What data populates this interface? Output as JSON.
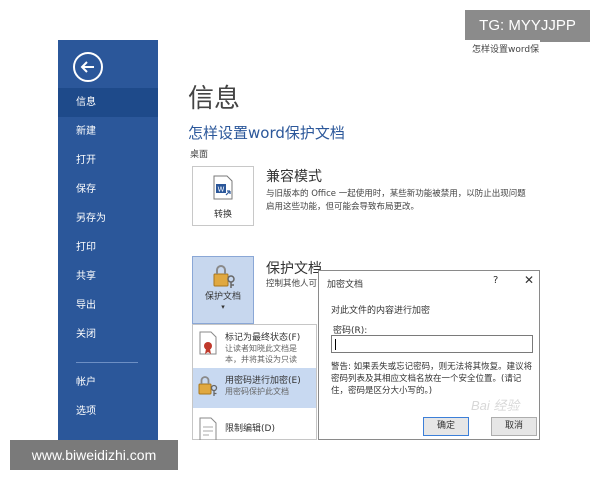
{
  "watermarks": {
    "top": "TG: MYYJJPP",
    "bottom": "www.biweidizhi.com",
    "dialog_logo": "Bai 经验"
  },
  "top_truncated_title": "怎样设置word保",
  "sidebar": {
    "back_icon": "back-arrow-icon",
    "items": [
      {
        "label": "信息",
        "active": true
      },
      {
        "label": "新建"
      },
      {
        "label": "打开"
      },
      {
        "label": "保存"
      },
      {
        "label": "另存为"
      },
      {
        "label": "打印"
      },
      {
        "label": "共享"
      },
      {
        "label": "导出"
      },
      {
        "label": "关闭"
      },
      {
        "label": "帐户"
      },
      {
        "label": "选项"
      }
    ]
  },
  "main": {
    "page_title": "信息",
    "doc_title": "怎样设置word保护文档",
    "doc_location": "桌面",
    "compat": {
      "tile_label": "转换",
      "title": "兼容模式",
      "desc_line1": "与旧版本的 Office 一起使用时，某些新功能被禁用，以防止出现问题",
      "desc_line2": "启用这些功能，但可能会导致布局更改。"
    },
    "protect": {
      "tile_label": "保护文档",
      "tile_caret": "▾",
      "title": "保护文档",
      "desc": "控制其他人可"
    }
  },
  "protect_menu": {
    "items": [
      {
        "title": "标记为最终状态(F)",
        "desc_line1": "让读者知晓此文档是",
        "desc_line2": "本，并将其设为只读"
      },
      {
        "title": "用密码进行加密(E)",
        "desc_line1": "用密码保护此文档",
        "highlighted": true
      },
      {
        "title": "限制编辑(D)"
      }
    ]
  },
  "dialog": {
    "title": "加密文档",
    "help": "?",
    "close": "✕",
    "heading": "对此文件的内容进行加密",
    "password_label": "密码(R):",
    "password_value": "",
    "warning": "警告: 如果丢失或忘记密码，则无法将其恢复。建议将密码列表及其相应文档名放在一个安全位置。(请记住，密码是区分大小写的。)",
    "ok_label": "确定",
    "cancel_label": "取消"
  },
  "colors": {
    "sidebar_bg": "#2b579a",
    "accent": "#2b579a",
    "highlight": "#c8d9f1"
  }
}
